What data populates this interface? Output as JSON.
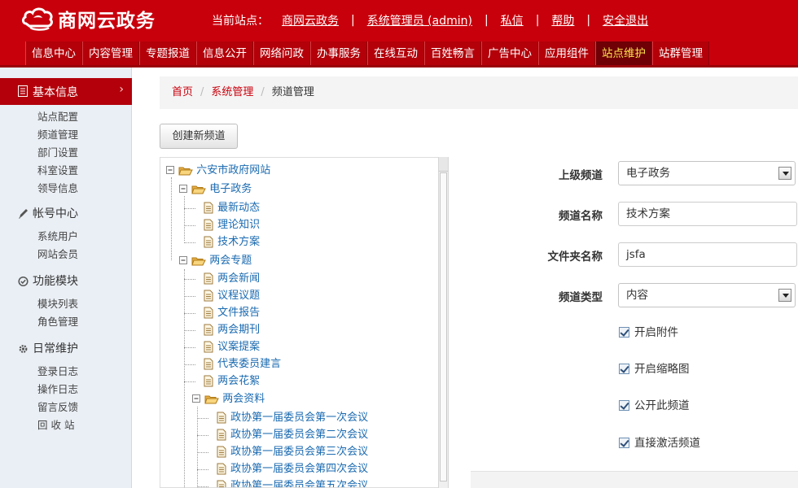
{
  "brand": {
    "name": "商网云政务"
  },
  "header": {
    "site_label": "当前站点：",
    "site_name": "商网云政务",
    "user": "系统管理员 (admin)",
    "message": "私信",
    "help": "帮助",
    "logout": "安全退出",
    "separator": "|"
  },
  "topnav": [
    "信息中心",
    "内容管理",
    "专题报道",
    "信息公开",
    "网络问政",
    "办事服务",
    "在线互动",
    "百姓畅言",
    "广告中心",
    "应用组件",
    "站点维护",
    "站群管理"
  ],
  "topnav_active": "站点维护",
  "sidebar": {
    "active_group": "基本信息",
    "active_items": [
      "站点配置",
      "频道管理",
      "部门设置",
      "科室设置",
      "领导信息"
    ],
    "groups": [
      {
        "title": "帐号中心",
        "icon": "pencil-icon",
        "items": [
          "系统用户",
          "网站会员"
        ]
      },
      {
        "title": "功能模块",
        "icon": "circle-check-icon",
        "items": [
          "模块列表",
          "角色管理"
        ]
      },
      {
        "title": "日常维护",
        "icon": "gear-icon",
        "items": [
          "登录日志",
          "操作日志",
          "留言反馈",
          "回 收 站"
        ]
      }
    ]
  },
  "breadcrumb": {
    "home": "首页",
    "section": "系统管理",
    "current": "频道管理",
    "separator": "/"
  },
  "create_button": "创建新频道",
  "tree": {
    "root": "六安市政府网站",
    "nodes": [
      {
        "label": "电子政务",
        "type": "folder"
      },
      {
        "label": "最新动态",
        "type": "page"
      },
      {
        "label": "理论知识",
        "type": "page"
      },
      {
        "label": "技术方案",
        "type": "page"
      },
      {
        "label": "两会专题",
        "type": "folder"
      },
      {
        "label": "两会新闻",
        "type": "page"
      },
      {
        "label": "议程议题",
        "type": "page"
      },
      {
        "label": "文件报告",
        "type": "page"
      },
      {
        "label": "两会期刊",
        "type": "page"
      },
      {
        "label": "议案提案",
        "type": "page"
      },
      {
        "label": "代表委员建言",
        "type": "page"
      },
      {
        "label": "两会花絮",
        "type": "page"
      },
      {
        "label": "两会资料",
        "type": "folder"
      },
      {
        "label": "政协第一届委员会第一次会议",
        "type": "page"
      },
      {
        "label": "政协第一届委员会第二次会议",
        "type": "page"
      },
      {
        "label": "政协第一届委员会第三次会议",
        "type": "page"
      },
      {
        "label": "政协第一届委员会第四次会议",
        "type": "page"
      },
      {
        "label": "政协第一届委员会第五次会议",
        "type": "page"
      }
    ]
  },
  "form": {
    "parent_label": "上级频道",
    "parent_value": "电子政务",
    "name_label": "频道名称",
    "name_value": "技术方案",
    "folder_label": "文件夹名称",
    "folder_value": "jsfa",
    "type_label": "频道类型",
    "type_value": "内容",
    "checks": [
      {
        "label": "开启附件",
        "checked": true
      },
      {
        "label": "开启缩略图",
        "checked": true
      },
      {
        "label": "公开此频道",
        "checked": true
      },
      {
        "label": "直接激活频道",
        "checked": true
      }
    ]
  },
  "colors": {
    "brand_red": "#c8000c",
    "nav_active_bg": "#6e0006",
    "nav_active_text": "#ffe34d",
    "link_blue": "#1a6ab0",
    "sidebar_bg": "#eaeff5"
  }
}
